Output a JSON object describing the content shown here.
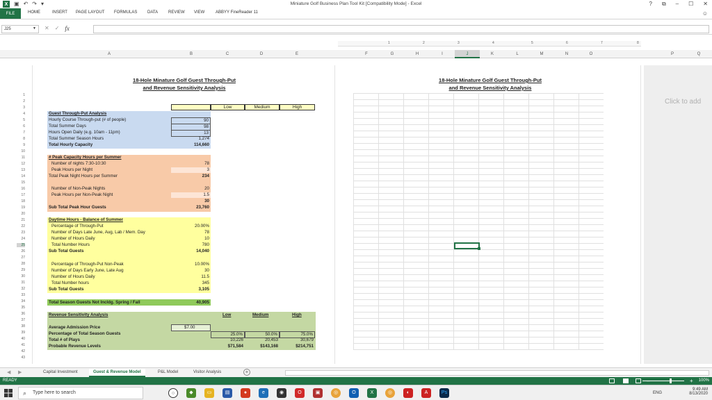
{
  "window": {
    "title": "Miniature Golf Business Plan Tool Kit  [Compatibility Mode] - Excel",
    "controls": {
      "help": "?",
      "restore": "⧉",
      "minimize": "–",
      "maximize": "☐",
      "close": "✕"
    }
  },
  "ribbon": {
    "file": "FILE",
    "tabs": [
      "HOME",
      "INSERT",
      "PAGE LAYOUT",
      "FORMULAS",
      "DATA",
      "REVIEW",
      "VIEW",
      "ABBYY FineReader 11"
    ]
  },
  "formula_bar": {
    "name_box": "J25",
    "fx": "fx",
    "value": ""
  },
  "ruler": [
    "1",
    "2",
    "3",
    "4",
    "5",
    "6",
    "7",
    "8"
  ],
  "columns": [
    "A",
    "B",
    "C",
    "D",
    "E",
    "F",
    "G",
    "H",
    "I",
    "J",
    "K",
    "L",
    "M",
    "N",
    "O",
    "P",
    "Q"
  ],
  "active_column": "J",
  "rows": [
    "1",
    "2",
    "3",
    "4",
    "5",
    "6",
    "7",
    "8",
    "9",
    "10",
    "11",
    "12",
    "13",
    "14",
    "15",
    "16",
    "17",
    "18",
    "19",
    "20",
    "21",
    "22",
    "23",
    "24",
    "25",
    "26",
    "27",
    "28",
    "29",
    "30",
    "31",
    "32",
    "33",
    "34",
    "35",
    "36",
    "37",
    "38",
    "39",
    "40",
    "41",
    "42",
    "43"
  ],
  "active_row": "25",
  "page_placeholder": "Click to add",
  "sheet": {
    "title_line1": "18-Hole Minature Golf Guest Through-Put",
    "title_line2": "and Revenue Sensitivity Analysis",
    "scenario_headers": [
      "Low",
      "Medium",
      "High"
    ],
    "throughput": {
      "heading": "Guest Through-Put Analysis",
      "rows": [
        {
          "label": "Hourly Course Through-put (# of people)",
          "value": "90"
        },
        {
          "label": "Total Summer Days",
          "value": "98"
        },
        {
          "label": "Hours Open Daily (e.g. 10am - 11pm)",
          "value": "13"
        },
        {
          "label": "Total Summer Season Hours",
          "value": "1,274"
        },
        {
          "label": "Total Hourly Capacity",
          "value": "114,660"
        }
      ]
    },
    "peak": {
      "heading": "# Peak Capacity Hours per Summer",
      "rows": [
        {
          "label": "Number of nights 7:30-10:30",
          "value": "78"
        },
        {
          "label": "Peak Hours per Night",
          "value": "3"
        },
        {
          "label": "Total Peak Night Hours per Summer",
          "value": "234"
        },
        {
          "label": "Number of Non-Peak Nights",
          "value": "20"
        },
        {
          "label": "Peak Hours per Non-Peak Night",
          "value": "1.5"
        },
        {
          "label": "",
          "value": "30"
        },
        {
          "label": "Sub Total Peak Hour Guests",
          "value": "23,760"
        }
      ]
    },
    "daytime": {
      "heading": "Daytime Hours - Balance of Summer",
      "rows": [
        {
          "label": "Percentage of Through-Put",
          "value": "20.00%"
        },
        {
          "label": "Number of Days Late June, Aug, Lab  / Mem. Day",
          "value": "78"
        },
        {
          "label": "Number of Hours Daily",
          "value": "10"
        },
        {
          "label": "Total  Number Hours",
          "value": "780"
        },
        {
          "label": "Sub Total Guests",
          "value": "14,040"
        }
      ],
      "nonpeak_rows": [
        {
          "label": "Percentage of Through-Put Non-Peak",
          "value": "10.00%"
        },
        {
          "label": "Number of Days Early June, Late Aug",
          "value": "30"
        },
        {
          "label": "Number of Hours Daily",
          "value": "11.5"
        },
        {
          "label": "Total  Number hours",
          "value": "345"
        },
        {
          "label": "Sub Total Guests",
          "value": "3,105"
        }
      ]
    },
    "season_total": {
      "label": "Total Season Guests Not Incldg. Spring / Fall",
      "value": "40,905"
    },
    "revenue": {
      "heading": "Revenue Sensitivity Analysis",
      "headers": [
        "Low",
        "Medium",
        "High"
      ],
      "admission_label": "Average Admission Price",
      "admission_value": "$7.00",
      "rows": [
        {
          "label": "Percentage of Total Season Guests",
          "values": [
            "25.0%",
            "50.0%",
            "75.0%"
          ]
        },
        {
          "label": "Total # of Plays",
          "values": [
            "10,226",
            "20,453",
            "30,679"
          ]
        },
        {
          "label": "Probable Revenue Levels",
          "values": [
            "$71,584",
            "$143,168",
            "$214,751"
          ]
        }
      ]
    }
  },
  "sheet_tabs": [
    "Capital Investment",
    "Guest & Revenue Model",
    "P&L Model",
    "Visitor Analysis"
  ],
  "active_sheet": "Guest & Revenue Model",
  "status": {
    "ready": "READY",
    "zoom": "100%"
  },
  "taskbar": {
    "search_placeholder": "Type here to search",
    "lang": "ENG",
    "time": "9:49 AM",
    "date": "8/13/2020"
  },
  "colors": {
    "excel_green": "#217346",
    "blue": "#c9daf0",
    "peach": "#f8caa8",
    "yellow": "#ffff9e",
    "green": "#c4d8a3"
  }
}
